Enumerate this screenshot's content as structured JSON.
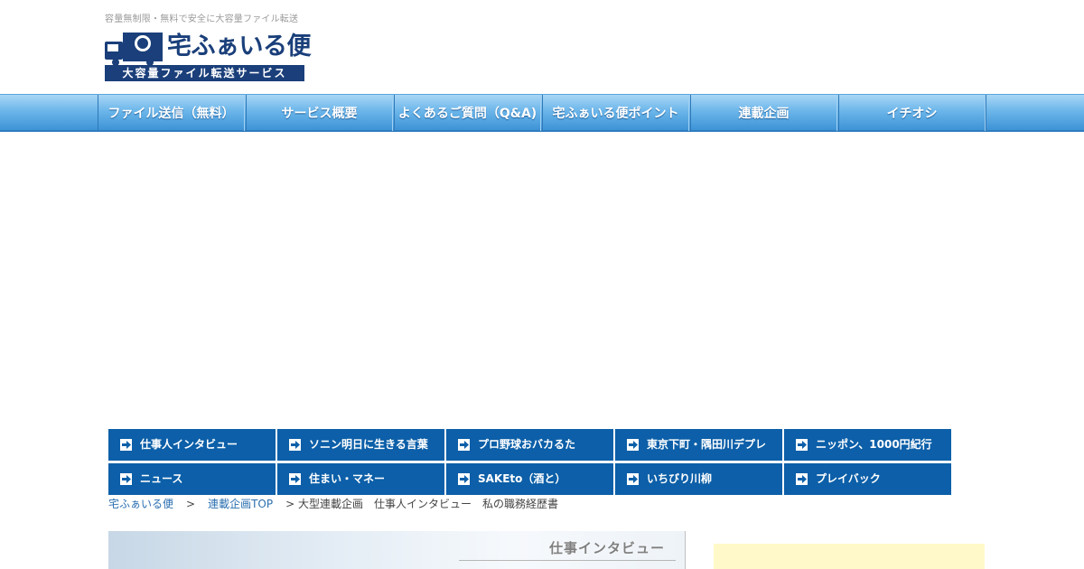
{
  "header": {
    "tagline": "容量無制限・無料で安全に大容量ファイル転送",
    "logo_name": "宅ふぁいる便",
    "logo_sub": "大容量ファイル転送サービス",
    "logo_icon": "truck-icon"
  },
  "global_nav": [
    {
      "label": "ファイル送信（無料）"
    },
    {
      "label": "サービス概要"
    },
    {
      "label": "よくあるご質問（Q&A)"
    },
    {
      "label": "宅ふぁいる便ポイント"
    },
    {
      "label": "連載企画"
    },
    {
      "label": "イチオシ"
    }
  ],
  "sub_nav": [
    {
      "label": "仕事人インタビュー"
    },
    {
      "label": "ソニン明日に生きる言葉"
    },
    {
      "label": "プロ野球おバカるた"
    },
    {
      "label": "東京下町・隅田川デプレ"
    },
    {
      "label": "ニッポン、1000円紀行"
    },
    {
      "label": "ニュース"
    },
    {
      "label": "住まい・マネー"
    },
    {
      "label": "SAKEto（酒と）"
    },
    {
      "label": "いちびり川柳"
    },
    {
      "label": "プレイバック"
    }
  ],
  "breadcrumb": {
    "home": "宅ふぁいる便",
    "sep": ">",
    "section": "連載企画TOP",
    "current": "> 大型連載企画　仕事人インタビュー　私の職務経歴書"
  },
  "hero": {
    "label": "仕事インタビュー"
  },
  "colors": {
    "brand_navy": "#1a3f7a",
    "nav_blue": "#0c5fa8",
    "link_blue": "#2a6fb0",
    "sidebar_yellow": "#fff9c9"
  }
}
